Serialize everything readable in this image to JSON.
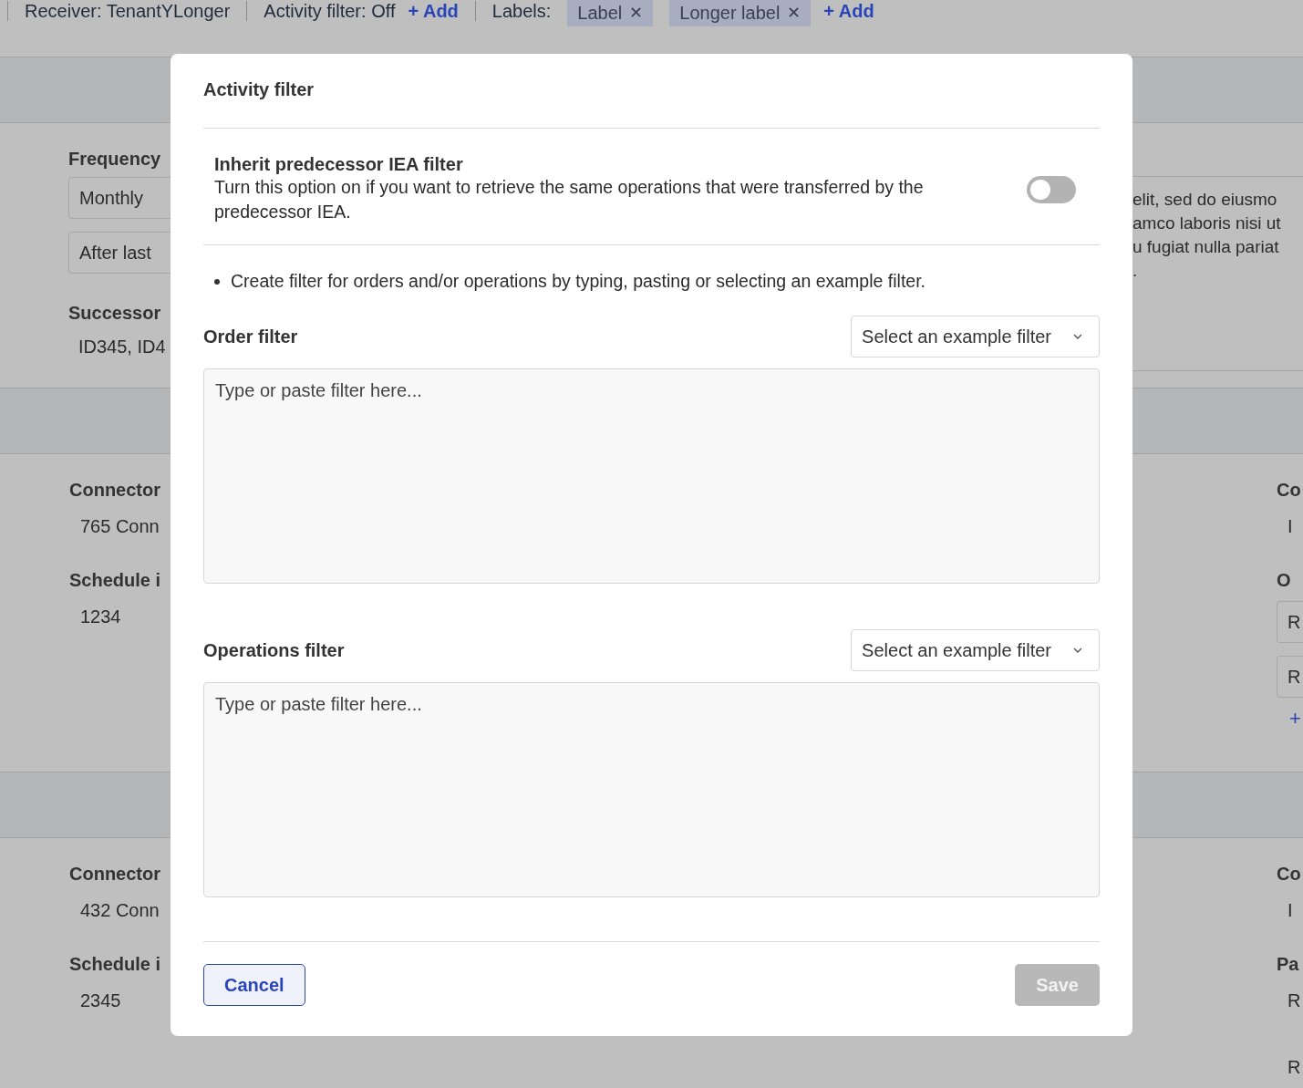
{
  "top_bar": {
    "receiver": "Receiver: TenantYLonger",
    "activity_filter": "Activity filter: Off",
    "add_activity": "+ Add",
    "labels_title": "Labels:",
    "labels": [
      {
        "text": "Label",
        "remove": "✕"
      },
      {
        "text": "Longer label",
        "remove": "✕"
      }
    ],
    "add_label": "+ Add"
  },
  "sections": [
    {
      "left": [
        {
          "kind": "heading",
          "text": "Frequency"
        },
        {
          "kind": "field",
          "text": "Monthly"
        },
        {
          "kind": "field",
          "text": "After last"
        },
        {
          "kind": "heading",
          "text": "Successor"
        },
        {
          "kind": "value",
          "text": "ID345, ID4"
        }
      ],
      "paragraph": [
        "elit, sed do eiusmo",
        "amco laboris nisi ut",
        "u fugiat nulla pariat",
        "."
      ]
    },
    {
      "left": [
        {
          "kind": "heading",
          "text": "Connector"
        },
        {
          "kind": "value",
          "text": "765 Conn"
        },
        {
          "kind": "heading",
          "text": "Schedule i"
        },
        {
          "kind": "value",
          "text": "1234"
        }
      ],
      "right": [
        {
          "kind": "heading",
          "text": "Co"
        },
        {
          "kind": "value",
          "text": "I"
        },
        {
          "kind": "heading",
          "text": "O"
        },
        {
          "kind": "field",
          "text": "R"
        },
        {
          "kind": "field",
          "text": "R"
        },
        {
          "kind": "add",
          "text": "+"
        }
      ]
    },
    {
      "left": [
        {
          "kind": "heading",
          "text": "Connector"
        },
        {
          "kind": "value",
          "text": "432 Conn"
        },
        {
          "kind": "heading",
          "text": "Schedule i"
        },
        {
          "kind": "value",
          "text": "2345"
        }
      ],
      "right": [
        {
          "kind": "heading",
          "text": "Co"
        },
        {
          "kind": "value",
          "text": "I"
        },
        {
          "kind": "heading",
          "text": "Pa"
        },
        {
          "kind": "value",
          "text": "R"
        },
        {
          "kind": "value",
          "text": "R"
        }
      ]
    }
  ],
  "modal": {
    "title": "Activity filter",
    "inherit": {
      "title": "Inherit predecessor IEA filter",
      "description": "Turn this option on if you want to retrieve the same operations that were transferred by the predecessor IEA.",
      "on": false
    },
    "hint": "Create filter for orders and/or operations by typing, pasting or selecting an example filter.",
    "filters": [
      {
        "label": "Order filter",
        "select": "Select an example filter",
        "placeholder": "Type or paste filter here..."
      },
      {
        "label": "Operations filter",
        "select": "Select an example filter",
        "placeholder": "Type or paste filter here..."
      }
    ],
    "cancel": "Cancel",
    "save": "Save",
    "save_disabled": true
  }
}
